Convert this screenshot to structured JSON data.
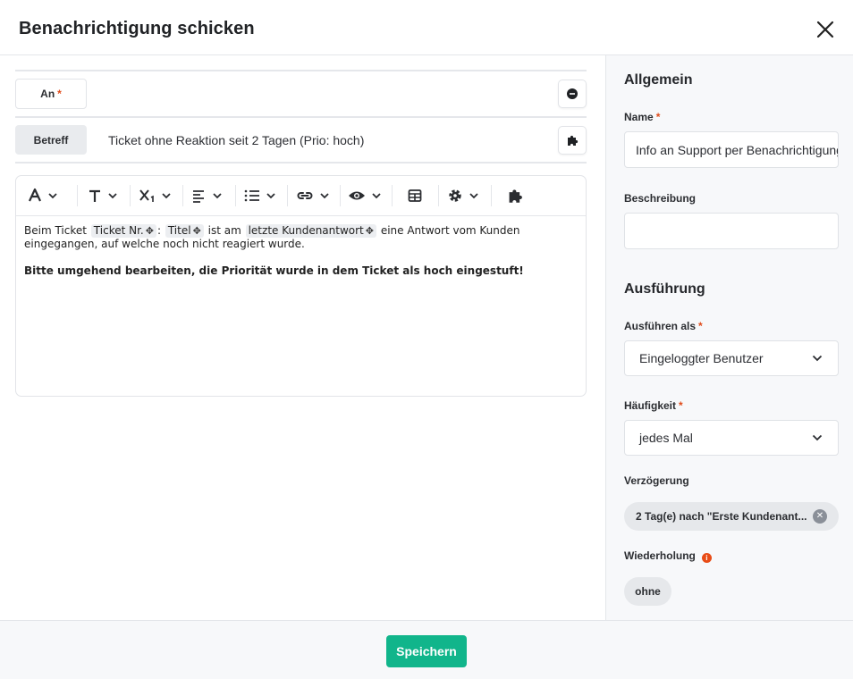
{
  "dialog": {
    "title": "Benachrichtigung schicken"
  },
  "recipient": {
    "label": "An",
    "required": "*"
  },
  "subject": {
    "label": "Betreff",
    "value": "Ticket ohne Reaktion seit 2 Tagen (Prio: hoch)"
  },
  "editor": {
    "toolbar": [
      "font-color",
      "text-style",
      "subscript",
      "align",
      "list",
      "link",
      "preview",
      "table",
      "settings",
      "plugins"
    ],
    "body": {
      "text1": "Beim Ticket",
      "chip1": "Ticket Nr.",
      "colon": ":",
      "chip2": "Titel",
      "text2": "ist am",
      "chip3": "letzte Kundenantwort",
      "text3": "eine Antwort vom Kunden eingegangen, auf welche noch nicht reagiert wurde.",
      "bold_line": "Bitte umgehend bearbeiten, die Priorität wurde in dem Ticket als hoch eingestuft!"
    }
  },
  "sidebar": {
    "general_title": "Allgemein",
    "name_label": "Name",
    "name_value": "Info an Support per Benachrichtigung",
    "description_label": "Beschreibung",
    "description_value": "",
    "execution_title": "Ausführung",
    "execute_as_label": "Ausführen als",
    "execute_as_value": "Eingeloggter Benutzer",
    "frequency_label": "Häufigkeit",
    "frequency_value": "jedes Mal",
    "delay_label": "Verzögerung",
    "delay_value": "2 Tag(e) nach \"Erste Kundenant...",
    "repeat_label": "Wiederholung",
    "repeat_value": "ohne",
    "required": "*"
  },
  "footer": {
    "save_label": "Speichern"
  },
  "colors": {
    "accent": "#11b58b",
    "required": "#e04b1a",
    "info": "#e84c16"
  }
}
